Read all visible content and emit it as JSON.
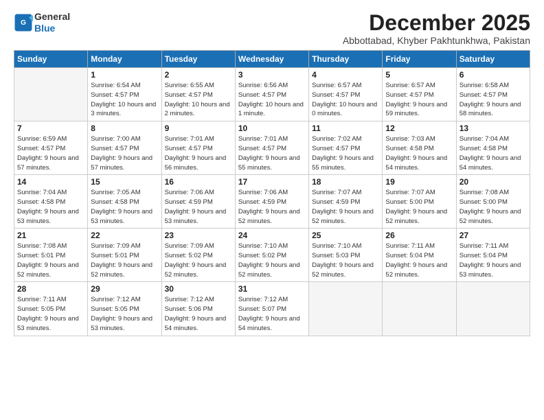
{
  "header": {
    "logo_general": "General",
    "logo_blue": "Blue",
    "month_title": "December 2025",
    "subtitle": "Abbottabad, Khyber Pakhtunkhwa, Pakistan"
  },
  "days_of_week": [
    "Sunday",
    "Monday",
    "Tuesday",
    "Wednesday",
    "Thursday",
    "Friday",
    "Saturday"
  ],
  "weeks": [
    [
      {
        "day": "",
        "info": ""
      },
      {
        "day": "1",
        "info": "Sunrise: 6:54 AM\nSunset: 4:57 PM\nDaylight: 10 hours\nand 3 minutes."
      },
      {
        "day": "2",
        "info": "Sunrise: 6:55 AM\nSunset: 4:57 PM\nDaylight: 10 hours\nand 2 minutes."
      },
      {
        "day": "3",
        "info": "Sunrise: 6:56 AM\nSunset: 4:57 PM\nDaylight: 10 hours\nand 1 minute."
      },
      {
        "day": "4",
        "info": "Sunrise: 6:57 AM\nSunset: 4:57 PM\nDaylight: 10 hours\nand 0 minutes."
      },
      {
        "day": "5",
        "info": "Sunrise: 6:57 AM\nSunset: 4:57 PM\nDaylight: 9 hours\nand 59 minutes."
      },
      {
        "day": "6",
        "info": "Sunrise: 6:58 AM\nSunset: 4:57 PM\nDaylight: 9 hours\nand 58 minutes."
      }
    ],
    [
      {
        "day": "7",
        "info": "Sunrise: 6:59 AM\nSunset: 4:57 PM\nDaylight: 9 hours\nand 57 minutes."
      },
      {
        "day": "8",
        "info": "Sunrise: 7:00 AM\nSunset: 4:57 PM\nDaylight: 9 hours\nand 57 minutes."
      },
      {
        "day": "9",
        "info": "Sunrise: 7:01 AM\nSunset: 4:57 PM\nDaylight: 9 hours\nand 56 minutes."
      },
      {
        "day": "10",
        "info": "Sunrise: 7:01 AM\nSunset: 4:57 PM\nDaylight: 9 hours\nand 55 minutes."
      },
      {
        "day": "11",
        "info": "Sunrise: 7:02 AM\nSunset: 4:57 PM\nDaylight: 9 hours\nand 55 minutes."
      },
      {
        "day": "12",
        "info": "Sunrise: 7:03 AM\nSunset: 4:58 PM\nDaylight: 9 hours\nand 54 minutes."
      },
      {
        "day": "13",
        "info": "Sunrise: 7:04 AM\nSunset: 4:58 PM\nDaylight: 9 hours\nand 54 minutes."
      }
    ],
    [
      {
        "day": "14",
        "info": "Sunrise: 7:04 AM\nSunset: 4:58 PM\nDaylight: 9 hours\nand 53 minutes."
      },
      {
        "day": "15",
        "info": "Sunrise: 7:05 AM\nSunset: 4:58 PM\nDaylight: 9 hours\nand 53 minutes."
      },
      {
        "day": "16",
        "info": "Sunrise: 7:06 AM\nSunset: 4:59 PM\nDaylight: 9 hours\nand 53 minutes."
      },
      {
        "day": "17",
        "info": "Sunrise: 7:06 AM\nSunset: 4:59 PM\nDaylight: 9 hours\nand 52 minutes."
      },
      {
        "day": "18",
        "info": "Sunrise: 7:07 AM\nSunset: 4:59 PM\nDaylight: 9 hours\nand 52 minutes."
      },
      {
        "day": "19",
        "info": "Sunrise: 7:07 AM\nSunset: 5:00 PM\nDaylight: 9 hours\nand 52 minutes."
      },
      {
        "day": "20",
        "info": "Sunrise: 7:08 AM\nSunset: 5:00 PM\nDaylight: 9 hours\nand 52 minutes."
      }
    ],
    [
      {
        "day": "21",
        "info": "Sunrise: 7:08 AM\nSunset: 5:01 PM\nDaylight: 9 hours\nand 52 minutes."
      },
      {
        "day": "22",
        "info": "Sunrise: 7:09 AM\nSunset: 5:01 PM\nDaylight: 9 hours\nand 52 minutes."
      },
      {
        "day": "23",
        "info": "Sunrise: 7:09 AM\nSunset: 5:02 PM\nDaylight: 9 hours\nand 52 minutes."
      },
      {
        "day": "24",
        "info": "Sunrise: 7:10 AM\nSunset: 5:02 PM\nDaylight: 9 hours\nand 52 minutes."
      },
      {
        "day": "25",
        "info": "Sunrise: 7:10 AM\nSunset: 5:03 PM\nDaylight: 9 hours\nand 52 minutes."
      },
      {
        "day": "26",
        "info": "Sunrise: 7:11 AM\nSunset: 5:04 PM\nDaylight: 9 hours\nand 52 minutes."
      },
      {
        "day": "27",
        "info": "Sunrise: 7:11 AM\nSunset: 5:04 PM\nDaylight: 9 hours\nand 53 minutes."
      }
    ],
    [
      {
        "day": "28",
        "info": "Sunrise: 7:11 AM\nSunset: 5:05 PM\nDaylight: 9 hours\nand 53 minutes."
      },
      {
        "day": "29",
        "info": "Sunrise: 7:12 AM\nSunset: 5:05 PM\nDaylight: 9 hours\nand 53 minutes."
      },
      {
        "day": "30",
        "info": "Sunrise: 7:12 AM\nSunset: 5:06 PM\nDaylight: 9 hours\nand 54 minutes."
      },
      {
        "day": "31",
        "info": "Sunrise: 7:12 AM\nSunset: 5:07 PM\nDaylight: 9 hours\nand 54 minutes."
      },
      {
        "day": "",
        "info": ""
      },
      {
        "day": "",
        "info": ""
      },
      {
        "day": "",
        "info": ""
      }
    ]
  ]
}
